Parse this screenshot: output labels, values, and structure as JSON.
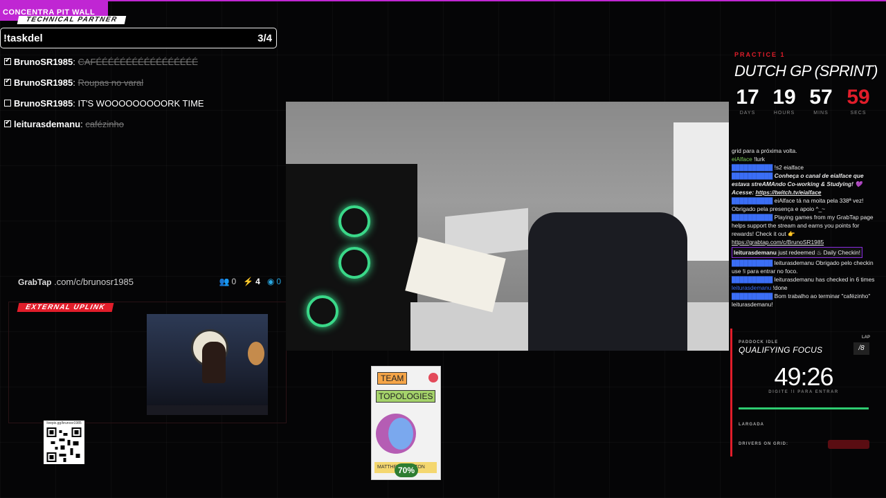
{
  "brand": {
    "title": "CONCENTRA PIT WALL",
    "partner_tag": "TECHNICAL PARTNER"
  },
  "tasks": {
    "command": "!taskdel",
    "count": "3/4",
    "items": [
      {
        "user": "BrunoSR1985",
        "text": "CAFÉÉÉÉÉÉÉÉÉÉÉÉÉÉÉÉÉ",
        "done": true
      },
      {
        "user": "BrunoSR1985",
        "text": "Roupas no varal",
        "done": true
      },
      {
        "user": "BrunoSR1985",
        "text": "IT'S WOOOOOOOOORK TIME",
        "done": false
      },
      {
        "user": "leiturasdemanu",
        "text": "cafézinho",
        "done": true
      }
    ]
  },
  "grabtap": {
    "logo": "GrabTap",
    "url": ".com/c/brunosr1985",
    "users_count": "0",
    "bolt_count": "4",
    "live_count": "0"
  },
  "uplink": {
    "tag": "EXTERNAL UPLINK"
  },
  "qr": {
    "label": "livepix.gg/brunosr1985"
  },
  "book": {
    "title_line1": "TEAM",
    "title_line2": "TOPOLOGIES",
    "author_line": "MATTHEW SKELTON",
    "progress_label": "70%"
  },
  "race": {
    "session": "PRACTICE 1",
    "title": "DUTCH GP (SPRINT)",
    "countdown": [
      {
        "value": "17",
        "label": "DAYS"
      },
      {
        "value": "19",
        "label": "HOURS"
      },
      {
        "value": "57",
        "label": "MINS"
      },
      {
        "value": "59",
        "label": "SECS"
      }
    ]
  },
  "chat": {
    "l1": "grid para a próxima volta.",
    "l2_name": "eiAlface",
    "l2_text": " !lurk",
    "l3_text": " !s2 eialface",
    "l4_text": " Conheça o canal de eialface que estava streAMAndo Co-working & Studying! 💜 Acesse: ",
    "l4_link": "https://twitch.tv/eialface",
    "l5_text": " eiAlface tá na moita pela 338ª vez! Obrigado pela presença e apoio ^_~",
    "l6_text": " Playing games from my GrabTap page helps support the stream and earns you points for rewards! Check it out 👉 ",
    "l6_link": "https://grabtap.com/c/BrunoSR1985",
    "redeem_name": "leiturasdemanu",
    "redeem_text": " just redeemed ♨ Daily Checkin!",
    "l7_text": " leiturasdemanu Obrigado pelo checkin use !i para entrar no foco.",
    "l8_text": " leiturasdemanu has checked in 6 times",
    "l9_name": "leiturasdemanu",
    "l9_text": " !done",
    "l10_text": " Bom trabalho ao terminar \"cafézinho\" leiturasdemanu!"
  },
  "quali": {
    "paddock": "PADDOCK IDLE",
    "lap_label": "LAP",
    "title": "QUALIFYING FOCUS",
    "lap_value": "/8",
    "timer": "49:26",
    "hint": "DIGITE !I PARA ENTRAR",
    "progress": 1.0,
    "start_label": "LARGADA",
    "drivers_label": "DRIVERS ON GRID:"
  },
  "colors": {
    "accent_magenta": "#c026d3",
    "accent_red": "#e11d2a",
    "progress_green": "#2ecc71",
    "chat_name_blue": "#3b6ef5",
    "chat_name_green": "#7ecb5b"
  }
}
